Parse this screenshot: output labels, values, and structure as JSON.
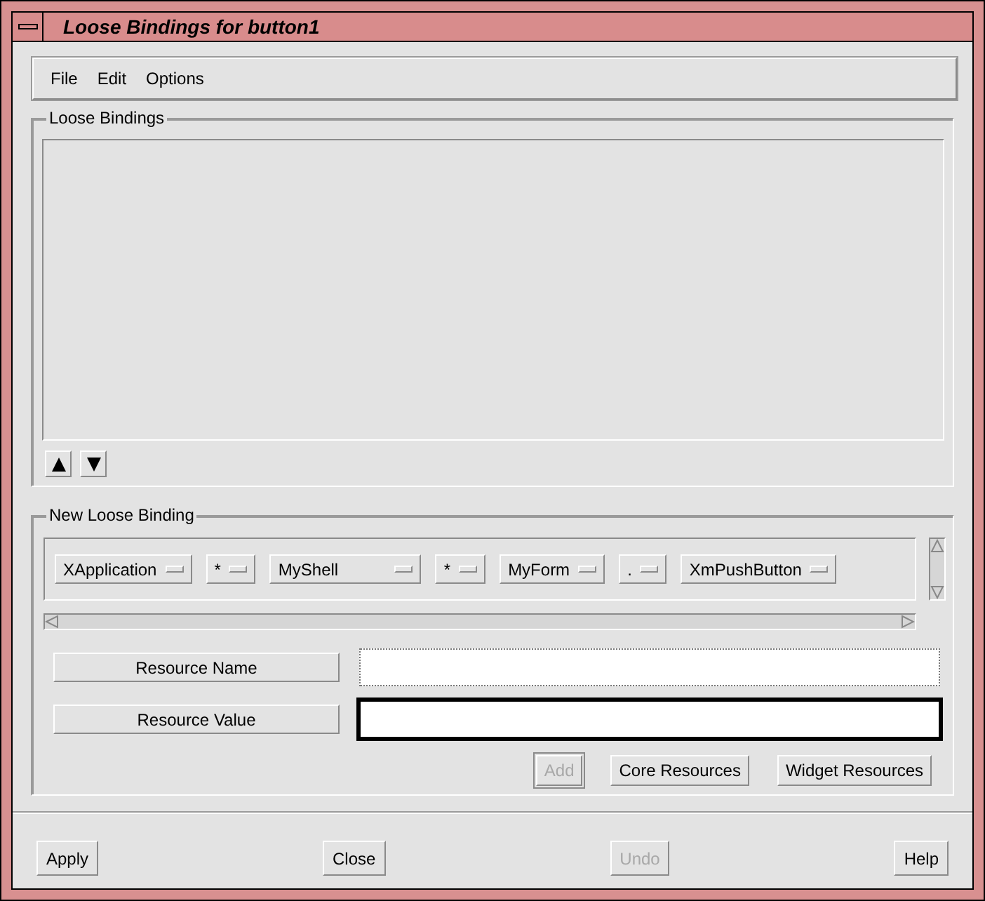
{
  "window": {
    "title": "Loose Bindings for button1"
  },
  "menu": [
    {
      "label": "File"
    },
    {
      "label": "Edit"
    },
    {
      "label": "Options"
    }
  ],
  "loose_bindings": {
    "title": "Loose Bindings"
  },
  "new_binding": {
    "title": "New Loose Binding",
    "parts": [
      {
        "label": "XApplication"
      },
      {
        "label": "*"
      },
      {
        "label": "MyShell"
      },
      {
        "label": "*"
      },
      {
        "label": "MyForm"
      },
      {
        "label": "."
      },
      {
        "label": "XmPushButton"
      }
    ]
  },
  "fields": [
    {
      "label": "Resource Name",
      "focused": false
    },
    {
      "label": "Resource Value",
      "focused": true
    }
  ],
  "action_buttons": [
    {
      "label": "Add",
      "disabled": true
    },
    {
      "label": "Core Resources",
      "disabled": false
    },
    {
      "label": "Widget Resources",
      "disabled": false
    }
  ],
  "dialog_buttons": [
    {
      "label": "Apply",
      "disabled": false
    },
    {
      "label": "Close",
      "disabled": false
    },
    {
      "label": "Undo",
      "disabled": true
    },
    {
      "label": "Help",
      "disabled": false
    }
  ]
}
